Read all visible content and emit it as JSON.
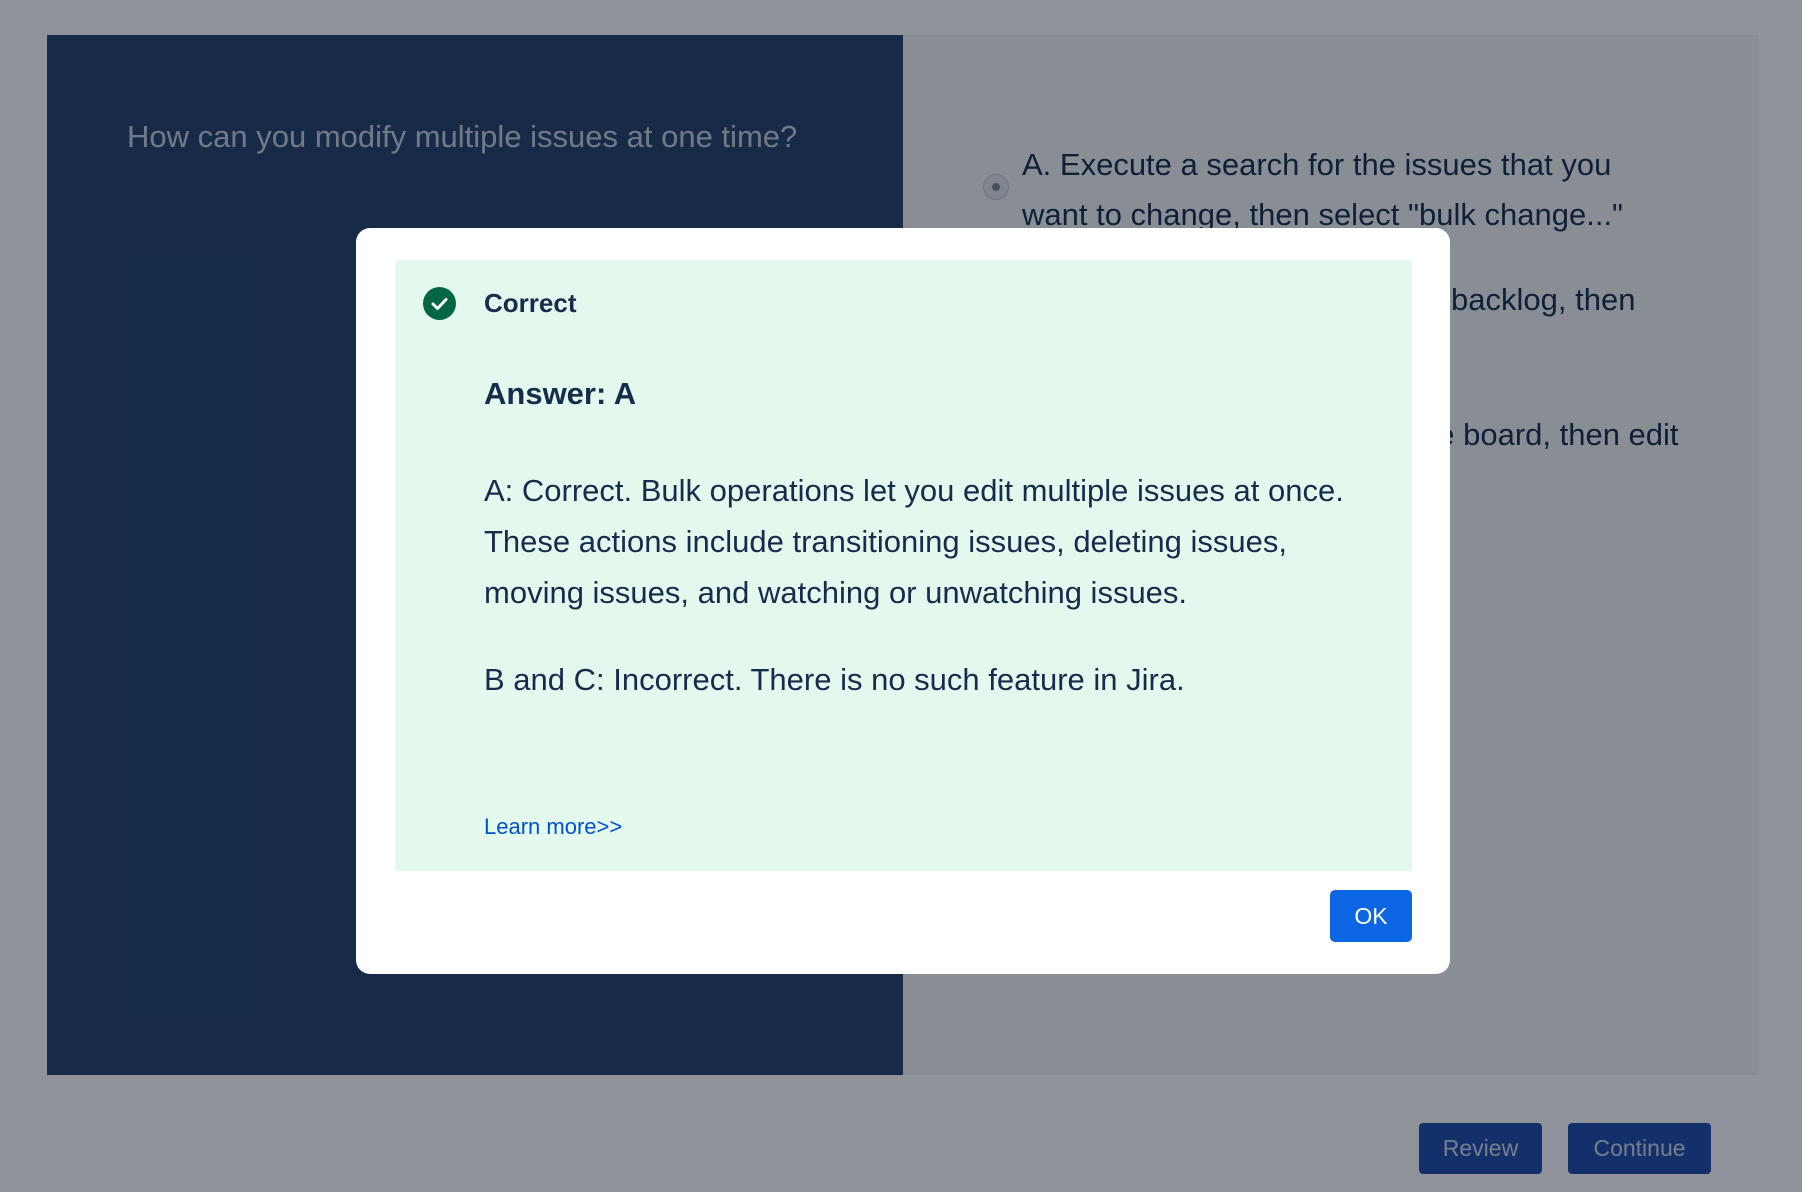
{
  "question": {
    "text": "How can you modify multiple issues at one time?"
  },
  "options": [
    {
      "label": "A. Execute a search for the issues that you want to change, then select \"bulk change...\""
    },
    {
      "label": "B. Select multiple issues in the backlog, then edit them"
    },
    {
      "label": "C. Select multiple issues on the board, then edit them"
    }
  ],
  "footer": {
    "review_label": "Review",
    "continue_label": "Continue"
  },
  "modal": {
    "status": "Correct",
    "answer_title": "Answer: A",
    "explanation_1": "A: Correct. Bulk operations let you edit multiple issues at once. These actions include transitioning issues, deleting issues, moving issues, and watching or unwatching issues.",
    "explanation_2": "B and C: Incorrect. There is no such feature in Jira.",
    "learn_more": "Learn more>>",
    "ok_label": "OK"
  },
  "colors": {
    "question_panel": "#23416b",
    "feedback_bg": "#e3f9ee",
    "success_icon": "#006644",
    "primary_button": "#0c66e4",
    "link": "#0052cc"
  },
  "icons": {
    "status": "check-circle-icon"
  }
}
